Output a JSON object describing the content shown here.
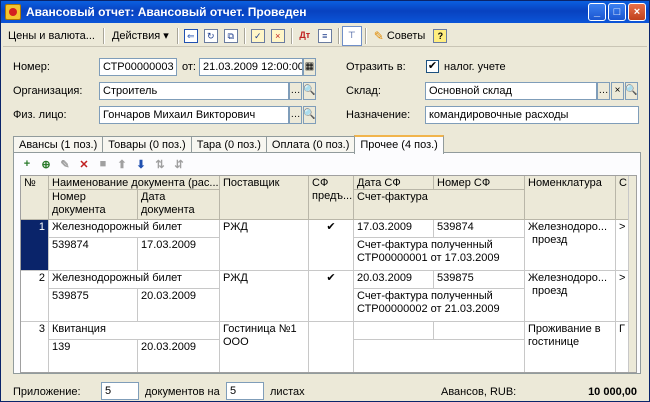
{
  "window": {
    "title": "Авансовый отчет: Авансовый отчет. Проведен",
    "minimize": "_",
    "maximize": "□",
    "close": "×"
  },
  "toolbar": {
    "prices_label": "Цены и валюта...",
    "actions_label": "Действия",
    "actions_arrow": "▾",
    "advice_label": "Советы",
    "help_label": "?"
  },
  "form": {
    "number_label": "Номер:",
    "number_value": "СТР00000003",
    "from_label": "от:",
    "date_value": "21.03.2009 12:00:00",
    "reflect_label": "Отразить в:",
    "tax_label": "налог. учете",
    "tax_checked": true,
    "org_label": "Организация:",
    "org_value": "Строитель",
    "warehouse_label": "Склад:",
    "warehouse_value": "Основной склад",
    "person_label": "Физ. лицо:",
    "person_value": "Гончаров Михаил Викторович",
    "purpose_label": "Назначение:",
    "purpose_value": "командировочные расходы"
  },
  "tabs": [
    {
      "label": "Авансы (1 поз.)"
    },
    {
      "label": "Товары (0 поз.)"
    },
    {
      "label": "Тара (0 поз.)"
    },
    {
      "label": "Оплата (0 поз.)"
    },
    {
      "label": "Прочее (4 поз.)",
      "active": true
    }
  ],
  "grid": {
    "headers": {
      "num": "№",
      "docname": "Наименование документа (рас...",
      "docnum": "Номер документа",
      "docdate": "Дата документа",
      "supplier": "Поставщик",
      "sf": "СФ предъ...",
      "sfdate": "Дата СФ",
      "sfnum": "Номер СФ",
      "sf_invoice": "Счет-фактура",
      "nomen": "Номенклатура",
      "extra": "С"
    },
    "rows": [
      {
        "n": "1",
        "name": "Железнодорожный билет",
        "docnum": "539874",
        "docdate": "17.03.2009",
        "supplier": "РЖД",
        "sf": "✔",
        "sfdate": "17.03.2009",
        "sfnum": "539874",
        "invoice1": "Счет-фактура полученный",
        "invoice2": "СТР00000001 от 17.03.2009",
        "nomen1": "Железнодоро...",
        "nomen2": "проезд"
      },
      {
        "n": "2",
        "name": "Железнодорожный билет",
        "docnum": "539875",
        "docdate": "20.03.2009",
        "supplier": "РЖД",
        "sf": "✔",
        "sfdate": "20.03.2009",
        "sfnum": "539875",
        "invoice1": "Счет-фактура полученный",
        "invoice2": "СТР00000002 от 21.03.2009",
        "nomen1": "Железнодоро...",
        "nomen2": "проезд"
      },
      {
        "n": "3",
        "name": "Квитанция",
        "docnum": "139",
        "docdate": "20.03.2009",
        "supplier1": "Гостиница №1",
        "supplier2": "ООО",
        "sf": "",
        "sfdate": "",
        "sfnum": "",
        "invoice1": "",
        "invoice2": "",
        "nomen1": "Проживание в",
        "nomen2": "гостинице"
      }
    ]
  },
  "footer": {
    "attach_label": "Приложение:",
    "attach_value": "5",
    "docs_label": "документов на",
    "sheets_value": "5",
    "sheets_label": "листах",
    "advances_label": "Авансов, RUB:",
    "advances_value": "10 000,00"
  }
}
